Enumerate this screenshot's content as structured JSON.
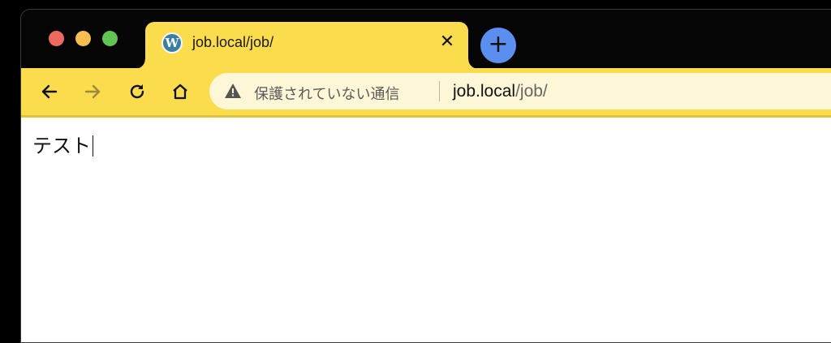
{
  "window": {
    "traffic_lights": [
      "close",
      "minimize",
      "zoom"
    ],
    "colors": {
      "frame": "#050505",
      "accent": "#fadc4c",
      "omnibox": "#fdf7d8",
      "newtab": "#5a8ff0"
    }
  },
  "tab": {
    "favicon": "wordpress-icon",
    "favicon_glyph": "W",
    "title": "job.local/job/",
    "close_label": "✕"
  },
  "newtab": {
    "label": "+"
  },
  "toolbar": {
    "back_icon": "arrow-left-icon",
    "forward_icon": "arrow-right-icon",
    "reload_icon": "reload-icon",
    "home_icon": "home-icon"
  },
  "omnibox": {
    "security_icon": "warning-icon",
    "security_text": "保護されていない通信",
    "url_host": "job.local",
    "url_path": "/job/"
  },
  "page": {
    "text": "テスト"
  }
}
